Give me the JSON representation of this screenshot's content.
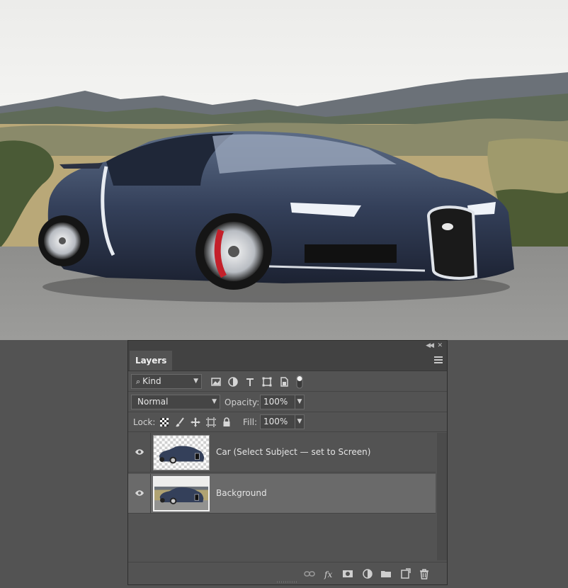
{
  "panel": {
    "tab_label": "Layers",
    "icons": {
      "collapse": "double-left-chevron-icon",
      "close": "close-icon",
      "menu": "hamburger-menu-icon"
    }
  },
  "filter": {
    "kind_label": "Kind",
    "icons": [
      "search-icon",
      "filter-pixel-layer-icon",
      "filter-adjustment-layer-icon",
      "filter-type-layer-icon",
      "filter-shape-layer-icon",
      "filter-smart-object-icon",
      "filter-toggle-icon"
    ]
  },
  "blend": {
    "mode": "Normal",
    "opacity_label": "Opacity:",
    "opacity_value": "100%"
  },
  "lock": {
    "label": "Lock:",
    "icons": [
      "lock-transparent-pixels-icon",
      "lock-image-pixels-icon",
      "lock-position-icon",
      "lock-artboard-icon",
      "lock-all-icon"
    ],
    "fill_label": "Fill:",
    "fill_value": "100%"
  },
  "layers": [
    {
      "name": "Car (Select Subject — set to Screen)",
      "visible": true,
      "selected": false,
      "thumbnail": "transparent-car-thumbnail"
    },
    {
      "name": "Background",
      "visible": true,
      "selected": true,
      "thumbnail": "photo-thumbnail"
    }
  ],
  "bottom_icons": [
    "link-layers-icon",
    "fx-icon",
    "add-mask-icon",
    "adjustment-layer-icon",
    "group-folder-icon",
    "new-layer-icon",
    "trash-icon"
  ],
  "colors": {
    "panel_bg": "#535353",
    "selected_row": "#6a6a6a",
    "tab_bar": "#424242"
  }
}
